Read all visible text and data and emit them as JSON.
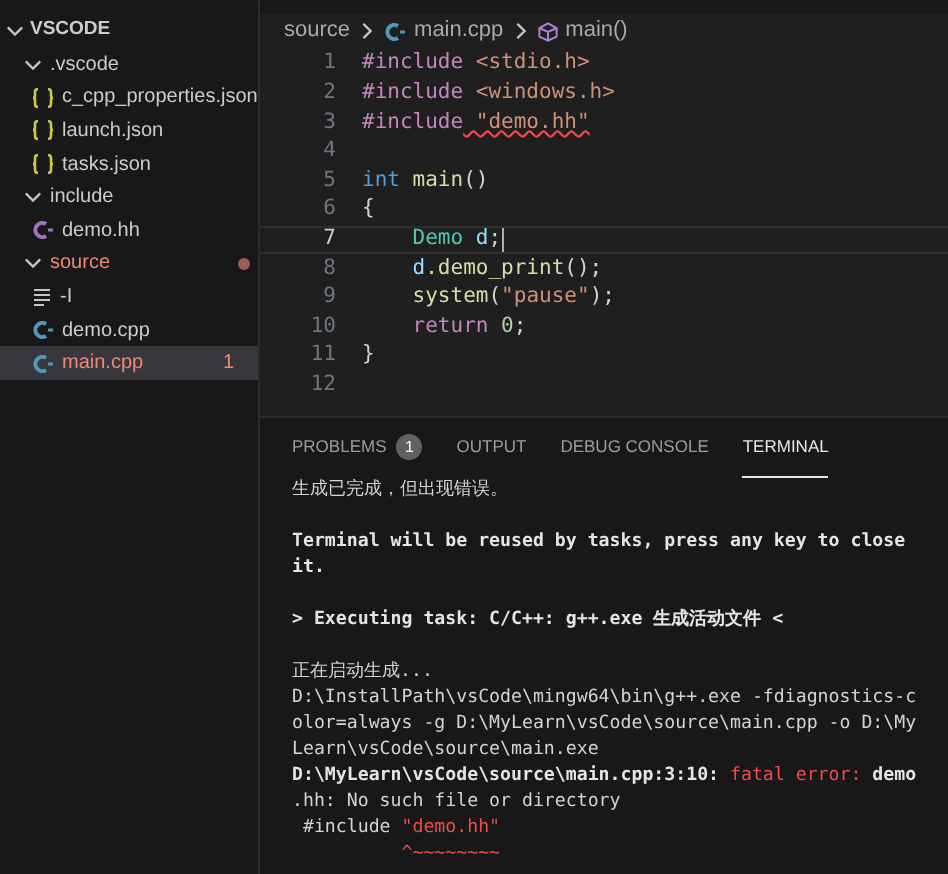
{
  "explorer": {
    "title": "VSCODE",
    "items": [
      {
        "label": ".vscode",
        "kind": "folder",
        "expanded": true,
        "error": false,
        "selected": false,
        "children": [
          {
            "label": "c_cpp_properties.json",
            "kind": "json",
            "error": false,
            "selected": false
          },
          {
            "label": "launch.json",
            "kind": "json",
            "error": false,
            "selected": false
          },
          {
            "label": "tasks.json",
            "kind": "json",
            "error": false,
            "selected": false
          }
        ]
      },
      {
        "label": "include",
        "kind": "folder",
        "expanded": true,
        "error": false,
        "selected": false,
        "children": [
          {
            "label": "demo.hh",
            "kind": "header",
            "error": false,
            "selected": false
          }
        ]
      },
      {
        "label": "source",
        "kind": "folder",
        "expanded": true,
        "error": true,
        "selected": false,
        "children": [
          {
            "label": "-I",
            "kind": "text",
            "error": false,
            "selected": false
          },
          {
            "label": "demo.cpp",
            "kind": "cpp",
            "error": false,
            "selected": false
          },
          {
            "label": "main.cpp",
            "kind": "cpp",
            "error": true,
            "selected": true,
            "badge": "1"
          }
        ]
      }
    ]
  },
  "breadcrumb": [
    "source",
    "main.cpp",
    "main()"
  ],
  "code": [
    {
      "number": "1",
      "selected": false,
      "tokens": [
        {
          "text": "#include",
          "kind": "directive"
        },
        {
          "text": " <stdio.h>",
          "kind": "string"
        }
      ]
    },
    {
      "number": "2",
      "selected": false,
      "tokens": [
        {
          "text": "#include",
          "kind": "directive"
        },
        {
          "text": " <windows.h>",
          "kind": "string"
        }
      ]
    },
    {
      "number": "3",
      "selected": false,
      "tokens": [
        {
          "text": "#include",
          "kind": "directive"
        },
        {
          "text": " \"demo.hh\"",
          "kind": "string",
          "error": true
        }
      ]
    },
    {
      "number": "4",
      "selected": false
    },
    {
      "number": "5",
      "selected": false,
      "tokens": [
        {
          "text": "int",
          "kind": "keyword"
        },
        {
          "text": " main",
          "kind": "func"
        },
        {
          "text": "()",
          "kind": "plain"
        }
      ]
    },
    {
      "number": "6",
      "selected": false,
      "tokens": [
        {
          "text": "{",
          "kind": "plain"
        }
      ]
    },
    {
      "number": "7",
      "selected": true,
      "tokens": [
        {
          "text": "    Demo",
          "kind": "type"
        },
        {
          "text": " d",
          "kind": "var"
        },
        {
          "text": ";",
          "kind": "plain"
        }
      ]
    },
    {
      "number": "8",
      "selected": false,
      "tokens": [
        {
          "text": "    d",
          "kind": "var"
        },
        {
          "text": ".demo_print",
          "kind": "func"
        },
        {
          "text": "();",
          "kind": "plain"
        }
      ]
    },
    {
      "number": "9",
      "selected": false,
      "tokens": [
        {
          "text": "    system",
          "kind": "func"
        },
        {
          "text": "(",
          "kind": "plain"
        },
        {
          "text": "\"pause\"",
          "kind": "string"
        },
        {
          "text": ");",
          "kind": "plain"
        }
      ]
    },
    {
      "number": "10",
      "selected": false,
      "tokens": [
        {
          "text": "    return",
          "kind": "directive"
        },
        {
          "text": " 0",
          "kind": "number"
        },
        {
          "text": ";",
          "kind": "plain"
        }
      ]
    },
    {
      "number": "11",
      "selected": false,
      "tokens": [
        {
          "text": "}",
          "kind": "plain"
        }
      ]
    },
    {
      "number": "12",
      "selected": false
    }
  ],
  "panel": {
    "tabs": [
      {
        "label": "PROBLEMS",
        "selected": false,
        "badge": "1"
      },
      {
        "label": "OUTPUT",
        "selected": false
      },
      {
        "label": "DEBUG CONSOLE",
        "selected": false
      },
      {
        "label": "TERMINAL",
        "selected": true
      }
    ],
    "terminal": [
      {
        "segments": [
          {
            "text": "生成已完成，但出现错误。",
            "kind": "plain"
          }
        ]
      },
      {
        "space_before": true,
        "segments": [
          {
            "text": "Terminal will be reused by tasks, press any key to close",
            "kind": "bold"
          }
        ]
      },
      {
        "segments": [
          {
            "text": "it.",
            "kind": "bold"
          }
        ]
      },
      {
        "space_before": true,
        "segments": [
          {
            "text": "> Executing task: C/C++: g++.exe 生成活动文件 <",
            "kind": "bold"
          }
        ]
      },
      {
        "space_before": true,
        "segments": [
          {
            "text": "正在启动生成...",
            "kind": "plain"
          }
        ]
      },
      {
        "segments": [
          {
            "text": "D:\\InstallPath\\vsCode\\mingw64\\bin\\g++.exe -fdiagnostics-c",
            "kind": "plain"
          }
        ]
      },
      {
        "segments": [
          {
            "text": "olor=always -g D:\\MyLearn\\vsCode\\source\\main.cpp -o D:\\My",
            "kind": "plain"
          }
        ]
      },
      {
        "segments": [
          {
            "text": "Learn\\vsCode\\source\\main.exe",
            "kind": "plain"
          }
        ]
      },
      {
        "segments": [
          {
            "text": "D:\\MyLearn\\vsCode\\source\\main.cpp:3:10: ",
            "kind": "bold"
          },
          {
            "text": "fatal error:",
            "kind": "error"
          },
          {
            "text": " demo",
            "kind": "bold"
          }
        ]
      },
      {
        "segments": [
          {
            "text": ".hh: No such file or directory",
            "kind": "plain"
          }
        ]
      },
      {
        "segments": [
          {
            "text": " #include ",
            "kind": "plain"
          },
          {
            "text": "\"demo.hh\"",
            "kind": "error"
          }
        ]
      },
      {
        "segments": [
          {
            "text": "          ^~~~~~~~~",
            "kind": "error"
          }
        ]
      }
    ]
  }
}
